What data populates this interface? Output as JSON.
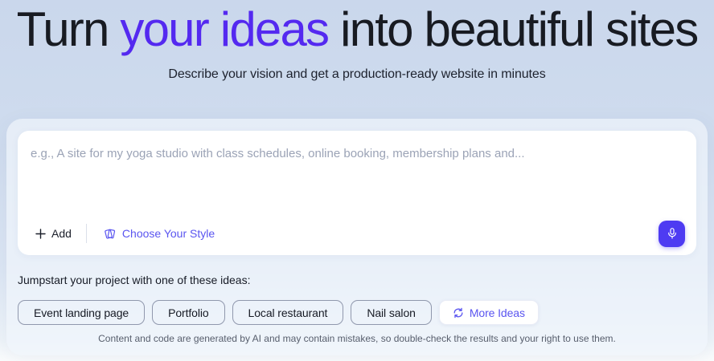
{
  "heading": {
    "part1": "Turn ",
    "highlight": "your ideas",
    "part2": " into beautiful sites"
  },
  "subtitle": "Describe your vision and get a production-ready website in minutes",
  "prompt": {
    "placeholder": "e.g., A site for my yoga studio with class schedules, online booking, membership plans and...",
    "value": "",
    "add_label": "Add",
    "choose_style_label": "Choose Your Style",
    "mic_icon": "microphone",
    "add_icon": "plus",
    "style_icon": "style-cards-fan"
  },
  "ideas": {
    "label": "Jumpstart your project with one of these ideas:",
    "chips": [
      "Event landing page",
      "Portfolio",
      "Local restaurant",
      "Nail salon"
    ],
    "more_label": "More Ideas",
    "more_icon": "refresh-arrows"
  },
  "disclaimer": "Content and code are generated by AI and may contain mistakes, so double-check the results and your right to use them.",
  "colors": {
    "accent_heading": "#5429f0",
    "accent_link": "#5a55f0",
    "mic_button": "#4e3bf2",
    "background_top": "#cad7ec",
    "panel": "#eff4fb",
    "card": "#ffffff"
  }
}
